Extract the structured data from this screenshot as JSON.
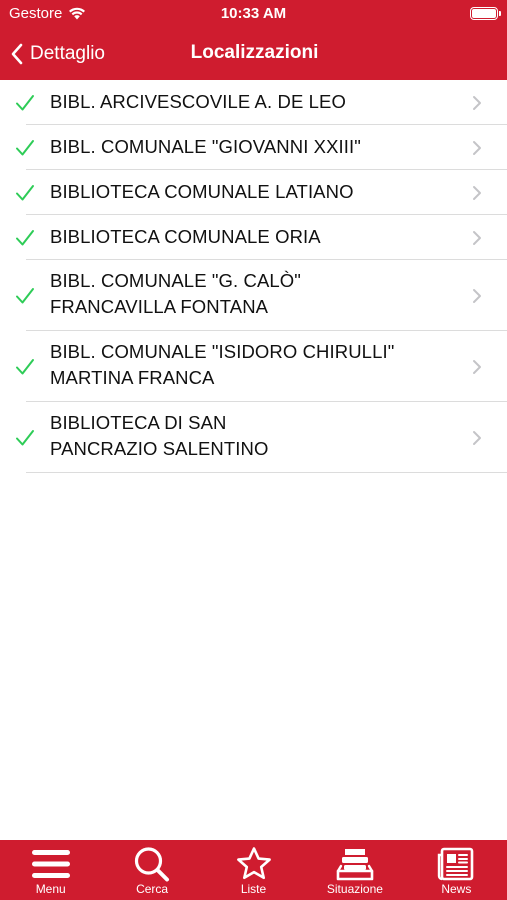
{
  "status_bar": {
    "carrier": "Gestore",
    "time": "10:33 AM"
  },
  "nav": {
    "back_label": "Dettaglio",
    "title": "Localizzazioni"
  },
  "locations": [
    {
      "label": "BIBL. ARCIVESCOVILE A. DE LEO",
      "available": true
    },
    {
      "label": "BIBL. COMUNALE \"GIOVANNI XXIII\"",
      "available": true
    },
    {
      "label": "BIBLIOTECA COMUNALE LATIANO",
      "available": true
    },
    {
      "label": "BIBLIOTECA COMUNALE ORIA",
      "available": true
    },
    {
      "label": "BIBL. COMUNALE \"G. CALÒ\"\nFRANCAVILLA FONTANA",
      "available": true
    },
    {
      "label": "BIBL. COMUNALE \"ISIDORO CHIRULLI\"\nMARTINA FRANCA",
      "available": true
    },
    {
      "label": "BIBLIOTECA DI SAN\nPANCRAZIO SALENTINO",
      "available": true
    }
  ],
  "tabbar": {
    "tabs": [
      {
        "label": "Menu",
        "icon": "menu-icon"
      },
      {
        "label": "Cerca",
        "icon": "search-icon"
      },
      {
        "label": "Liste",
        "icon": "star-icon"
      },
      {
        "label": "Situazione",
        "icon": "situation-icon"
      },
      {
        "label": "News",
        "icon": "news-icon"
      }
    ]
  },
  "colors": {
    "brand": "#cf1c2f",
    "check": "#2ecc57",
    "chevron": "#c4c4c7",
    "separator": "#dcdcdc"
  }
}
